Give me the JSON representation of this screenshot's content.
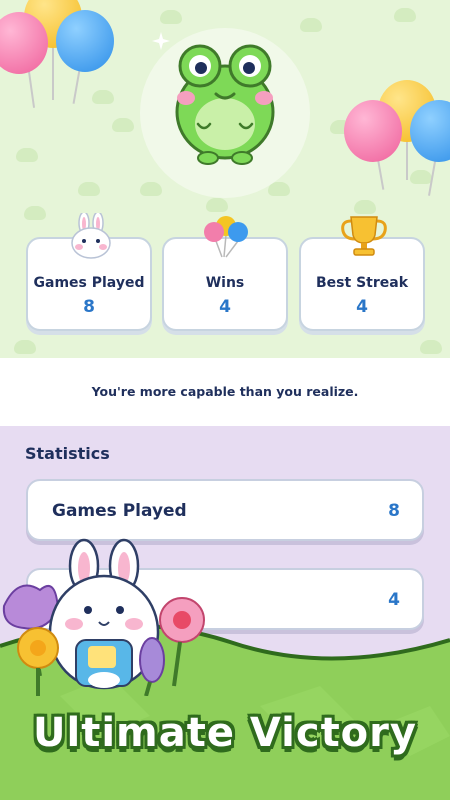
{
  "stats_cards": [
    {
      "label": "Games Played",
      "value": "8",
      "icon": "bunny-icon"
    },
    {
      "label": "Wins",
      "value": "4",
      "icon": "balloons-icon"
    },
    {
      "label": "Best Streak",
      "value": "4",
      "icon": "trophy-icon"
    }
  ],
  "quote": "You're more capable than you realize.",
  "statistics": {
    "title": "Statistics",
    "rows": [
      {
        "label": "Games Played",
        "value": "8"
      },
      {
        "label": "",
        "value": "4"
      }
    ]
  },
  "banner_title": "Ultimate Victory",
  "colors": {
    "navy_text": "#1f2f5c",
    "value_blue": "#2a76c8",
    "top_bg": "#e6f5d8",
    "panel_bg": "#e7dcf2",
    "grass": "#8fcf5a",
    "banner_outline": "#2f6b1d"
  }
}
